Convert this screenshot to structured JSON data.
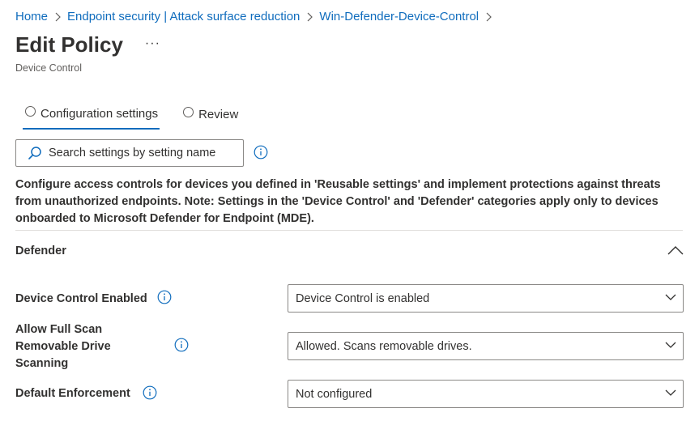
{
  "breadcrumb": {
    "items": [
      {
        "label": "Home"
      },
      {
        "label": "Endpoint security | Attack surface reduction"
      },
      {
        "label": "Win-Defender-Device-Control"
      }
    ]
  },
  "header": {
    "title": "Edit Policy",
    "more_label": "···",
    "subtitle": "Device Control"
  },
  "tabs": [
    {
      "label": "Configuration settings",
      "active": true
    },
    {
      "label": "Review",
      "active": false
    }
  ],
  "search": {
    "placeholder": "Search settings by setting name",
    "value": ""
  },
  "description": "Configure access controls for devices you defined in 'Reusable settings' and implement protections against threats from unauthorized endpoints. Note: Settings in the 'Device Control' and 'Defender' categories apply only to devices onboarded to Microsoft Defender for Endpoint (MDE).",
  "section": {
    "title": "Defender",
    "expanded": true
  },
  "settings": [
    {
      "label": "Device Control Enabled",
      "value": "Device Control is enabled"
    },
    {
      "label": "Allow Full Scan Removable Drive Scanning",
      "value": "Allowed. Scans removable drives."
    },
    {
      "label": "Default Enforcement",
      "value": "Not configured"
    }
  ],
  "colors": {
    "link": "#0f6cbd",
    "text": "#323130",
    "border": "#8a8886",
    "accent": "#0f6cbd"
  }
}
